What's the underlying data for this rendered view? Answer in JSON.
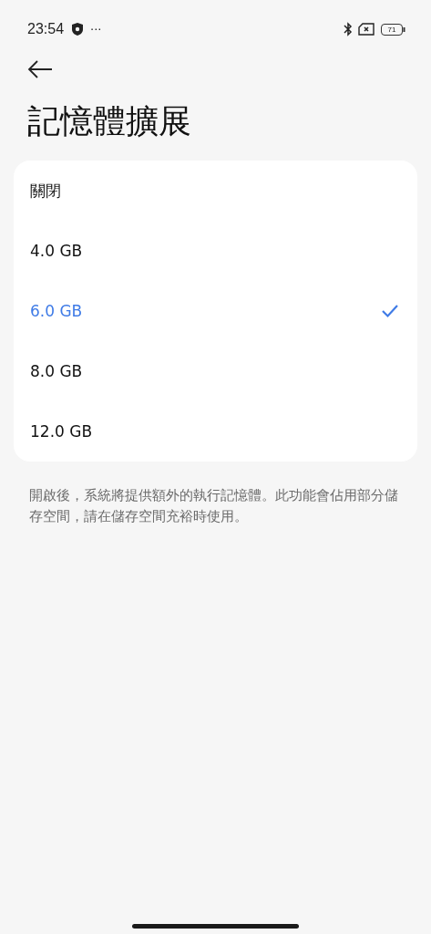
{
  "status_bar": {
    "time": "23:54",
    "more": "···",
    "battery": "71"
  },
  "title": "記憶體擴展",
  "options": [
    {
      "label": "關閉",
      "selected": false
    },
    {
      "label": "4.0 GB",
      "selected": false
    },
    {
      "label": "6.0 GB",
      "selected": true
    },
    {
      "label": "8.0 GB",
      "selected": false
    },
    {
      "label": "12.0 GB",
      "selected": false
    }
  ],
  "description": "開啟後，系統將提供額外的執行記憶體。此功能會佔用部分儲存空間，請在儲存空間充裕時使用。"
}
